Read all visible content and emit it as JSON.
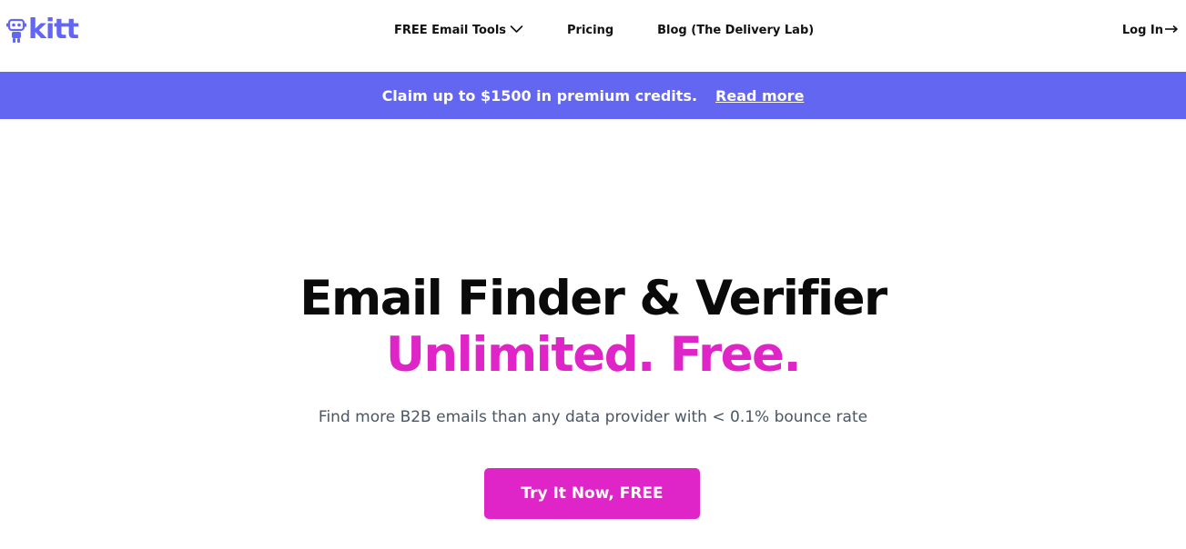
{
  "brand": {
    "name": "kitt",
    "logo_icon": "robot-icon",
    "accent_color": "#6366f1"
  },
  "nav": {
    "items": [
      {
        "label": "FREE Email Tools",
        "icon": "chevron-down-icon"
      },
      {
        "label": "Pricing"
      },
      {
        "label": "Blog (The Delivery Lab)"
      }
    ],
    "login_label": "Log In",
    "login_icon": "arrow-right-icon"
  },
  "banner": {
    "text": "Claim up to $1500 in premium credits.",
    "link_label": "Read more",
    "background": "#6366f1"
  },
  "hero": {
    "title": "Email Finder & Verifier",
    "title_accent": "Unlimited. Free.",
    "accent_color": "#e025c8",
    "subtitle": "Find more B2B emails than any data provider with < 0.1% bounce rate",
    "cta_label": "Try It Now, FREE"
  }
}
